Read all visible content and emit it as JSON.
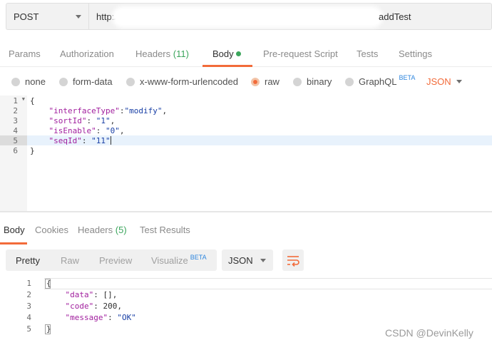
{
  "request": {
    "method": "POST",
    "url_prefix": "http:/",
    "url_suffix": "addTest"
  },
  "request_tabs": {
    "params": "Params",
    "authorization": "Authorization",
    "headers": "Headers",
    "headers_count": "(11)",
    "body": "Body",
    "pre_request": "Pre-request Script",
    "tests": "Tests",
    "settings": "Settings"
  },
  "body_options": {
    "none": "none",
    "form_data": "form-data",
    "urlencoded": "x-www-form-urlencoded",
    "raw": "raw",
    "binary": "binary",
    "graphql": "GraphQL",
    "beta": "BETA",
    "format": "JSON",
    "selected": "raw"
  },
  "request_body": {
    "line_numbers": [
      "1",
      "2",
      "3",
      "4",
      "5",
      "6"
    ],
    "open_brace": "{",
    "close_brace": "}",
    "fields": [
      {
        "key": "\"interfaceType\"",
        "sep": ":",
        "value": "\"modify\"",
        "trail": ","
      },
      {
        "key": "\"sortId\"",
        "sep": ": ",
        "value": "\"1\"",
        "trail": ","
      },
      {
        "key": "\"isEnable\"",
        "sep": ": ",
        "value": "\"0\"",
        "trail": ","
      },
      {
        "key": "\"seqId\"",
        "sep": ": ",
        "value": "\"11\"",
        "trail": ""
      }
    ]
  },
  "response_tabs": {
    "body": "Body",
    "cookies": "Cookies",
    "headers": "Headers",
    "headers_count": "(5)",
    "test_results": "Test Results"
  },
  "response_toolbar": {
    "pretty": "Pretty",
    "raw": "Raw",
    "preview": "Preview",
    "visualize": "Visualize",
    "beta": "BETA",
    "format": "JSON"
  },
  "response_body": {
    "line_numbers": [
      "1",
      "2",
      "3",
      "4",
      "5"
    ],
    "open_brace": "{",
    "close_brace": "}",
    "fields": [
      {
        "key": "\"data\"",
        "value": "[]",
        "trail": ","
      },
      {
        "key": "\"code\"",
        "value": "200",
        "trail": ","
      },
      {
        "key": "\"message\"",
        "value": "\"OK\"",
        "trail": ""
      }
    ]
  },
  "watermark": "CSDN @DevinKelly",
  "icons": {
    "dropdown": "chevron-down-icon",
    "wrap": "wrap-lines-icon",
    "fold": "fold-arrow-icon"
  },
  "colors": {
    "accent": "#f26b3a",
    "success": "#3ba55c",
    "beta": "#2e86de",
    "json_key": "#a11f9e",
    "json_string": "#1a40a6"
  }
}
